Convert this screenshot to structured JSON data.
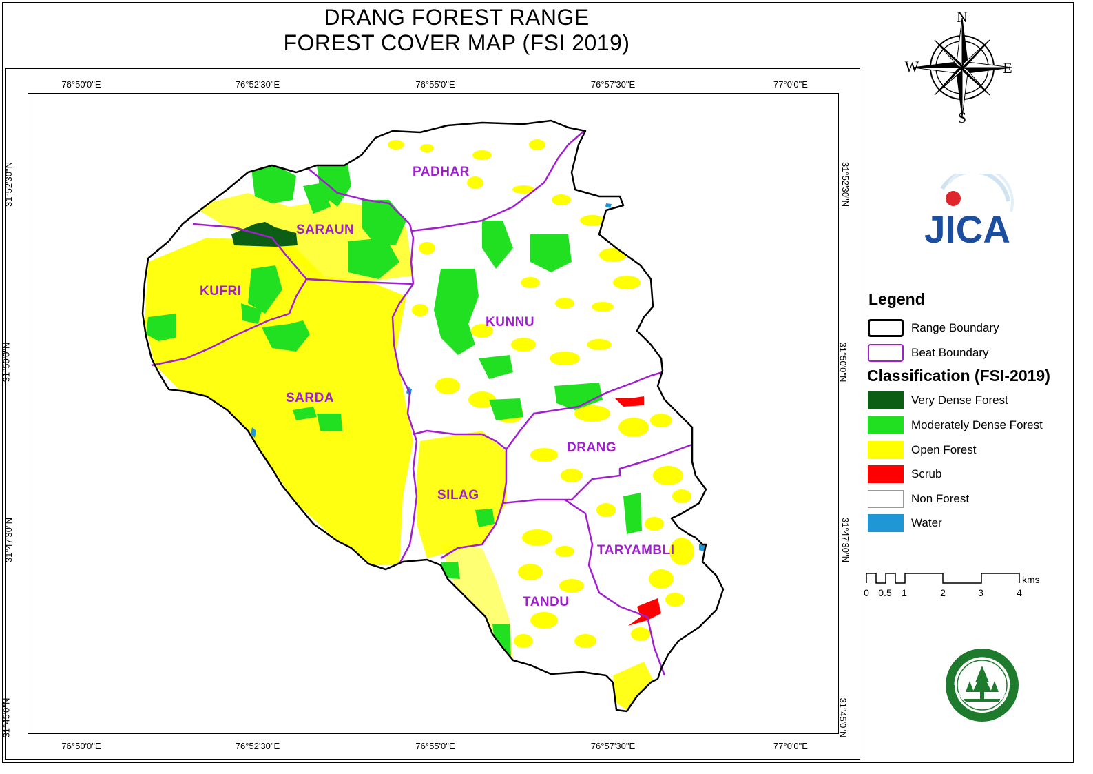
{
  "title": {
    "line1": "DRANG FOREST RANGE",
    "line2": "FOREST COVER MAP (FSI 2019)"
  },
  "graticule": {
    "longitudes": [
      "76°50'0\"E",
      "76°52'30\"E",
      "76°55'0\"E",
      "76°57'30\"E",
      "77°0'0\"E"
    ],
    "latitudes": [
      "31°52'30\"N",
      "31°50'0\"N",
      "31°47'30\"N",
      "31°45'0\"N"
    ]
  },
  "compass": {
    "north": "N",
    "south": "S",
    "east": "E",
    "west": "W"
  },
  "beats": {
    "padhar": "PADHAR",
    "saraun": "SARAUN",
    "kufri": "KUFRI",
    "kunnu": "KUNNU",
    "sarda": "SARDA",
    "drang": "DRANG",
    "silag": "SILAG",
    "taryambli": "TARYAMBLI",
    "tandu": "TANDU"
  },
  "legend": {
    "title": "Legend",
    "boundaries": [
      {
        "label": "Range Boundary",
        "color": "#000000"
      },
      {
        "label": "Beat Boundary",
        "color": "#a11fd0"
      }
    ],
    "classification_title": "Classification (FSI-2019)",
    "classes": [
      {
        "label": "Very Dense Forest",
        "color": "#0b5e14"
      },
      {
        "label": "Moderately Dense Forest",
        "color": "#21e021"
      },
      {
        "label": "Open Forest",
        "color": "#ffff00"
      },
      {
        "label": "Scrub",
        "color": "#ff0000"
      },
      {
        "label": "Non Forest",
        "color": "#ffffff"
      },
      {
        "label": "Water",
        "color": "#1f97d6"
      }
    ]
  },
  "scale": {
    "labels": [
      "0",
      "0.5",
      "1",
      "2",
      "3",
      "4"
    ],
    "unit": "kms"
  },
  "logos": {
    "jica": "JICA"
  }
}
